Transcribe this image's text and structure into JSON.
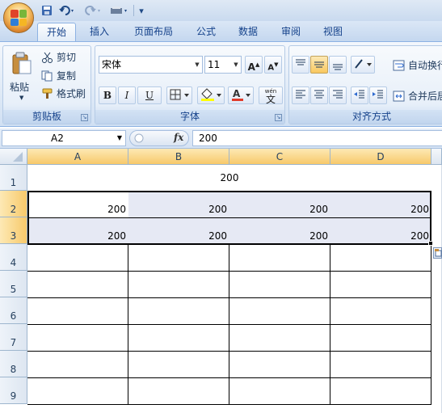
{
  "quick_access": {
    "undo_icon": "undo-icon",
    "redo_icon": "redo-icon",
    "save_icon": "save-icon",
    "customize": "▾"
  },
  "tabs": [
    {
      "label": "开始"
    },
    {
      "label": "插入"
    },
    {
      "label": "页面布局"
    },
    {
      "label": "公式"
    },
    {
      "label": "数据"
    },
    {
      "label": "审阅"
    },
    {
      "label": "视图"
    }
  ],
  "ribbon": {
    "clipboard": {
      "paste": "粘贴",
      "cut": "剪切",
      "copy": "复制",
      "format_painter": "格式刷",
      "label": "剪贴板"
    },
    "font": {
      "name": "宋体",
      "size": "11",
      "grow": "A",
      "shrink": "A",
      "bold": "B",
      "italic": "I",
      "underline": "U",
      "wen": "wén",
      "wen_char": "文",
      "label": "字体"
    },
    "alignment": {
      "wrap": "自动换行",
      "merge": "合并后居中",
      "label": "对齐方式"
    }
  },
  "formula_bar": {
    "name_box": "A2",
    "fx": "fx",
    "value": "200"
  },
  "columns": [
    "A",
    "B",
    "C",
    "D"
  ],
  "rows": [
    "1",
    "2",
    "3",
    "4",
    "5",
    "6",
    "7",
    "8",
    "9"
  ],
  "cells": {
    "r1_merged": "200",
    "r2": [
      "200",
      "200",
      "200",
      "200"
    ],
    "r3": [
      "200",
      "200",
      "200",
      "200"
    ]
  },
  "colors": {
    "accent": "#f7c96a",
    "selection_fill": "#e6e9f4",
    "ribbon_text": "#15428b"
  }
}
